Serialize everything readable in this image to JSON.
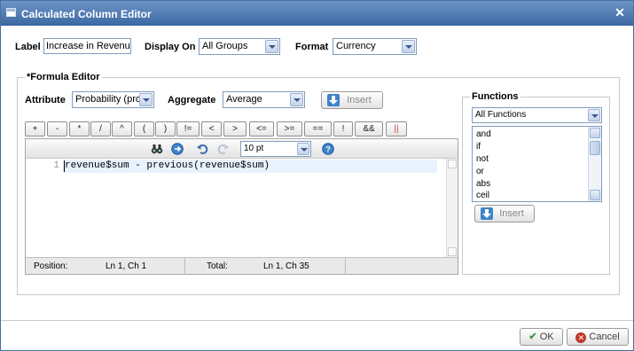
{
  "dialog": {
    "title": "Calculated Column Editor",
    "icons": [
      "window-icon",
      "close-icon"
    ]
  },
  "top_row": {
    "label_label": "Label",
    "label_value": "Increase in Revenue",
    "display_on_label": "Display On",
    "display_on_value": "All Groups",
    "format_label": "Format",
    "format_value": "Currency"
  },
  "formula_editor": {
    "legend": "*Formula Editor",
    "attribute_label": "Attribute",
    "attribute_value": "Probability (pro",
    "aggregate_label": "Aggregate",
    "aggregate_value": "Average",
    "insert_label": "Insert",
    "operators": [
      "+",
      "-",
      "*",
      "/",
      "^",
      "(",
      ")",
      "!=",
      "<",
      ">",
      "<=",
      ">=",
      "==",
      "!",
      "&&",
      "||"
    ],
    "font_size_value": "10 pt",
    "code": {
      "line_number": "1",
      "text": "revenue$sum - previous(revenue$sum)"
    },
    "status": {
      "position_label": "Position:",
      "position_value": "Ln 1, Ch 1",
      "total_label": "Total:",
      "total_value": "Ln 1, Ch 35"
    }
  },
  "functions": {
    "legend": "Functions",
    "filter_value": "All Functions",
    "items": [
      "and",
      "if",
      "not",
      "or",
      "abs",
      "ceil"
    ],
    "insert_label": "Insert"
  },
  "footer": {
    "ok_label": "OK",
    "cancel_label": "Cancel"
  },
  "colors": {
    "titlebar": "#4a76ad",
    "accent_blue": "#3e83c8",
    "ok_green": "#3c9a3c",
    "cancel_red": "#c0392b"
  }
}
